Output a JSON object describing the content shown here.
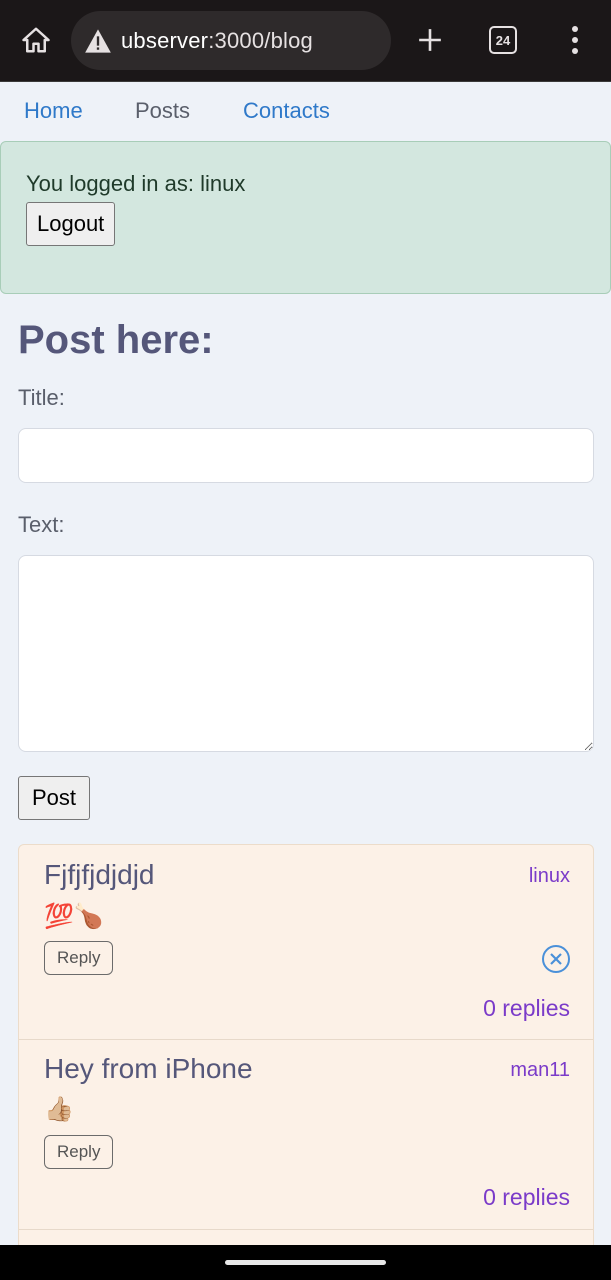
{
  "browser": {
    "url_host": "ubserver",
    "url_path": ":3000/blog",
    "tab_count": "24",
    "icons": {
      "home": "home-icon",
      "warning": "warning-icon",
      "new_tab": "plus-icon",
      "tabs": "tab-switcher-icon",
      "menu": "more-vert-icon"
    }
  },
  "nav": {
    "home": "Home",
    "posts": "Posts",
    "contacts": "Contacts",
    "link_color": "#2f79c9",
    "active_color": "#5a5f6b"
  },
  "login": {
    "text": "You logged in as: linux",
    "logout_label": "Logout"
  },
  "form": {
    "heading": "Post here:",
    "title_label": "Title:",
    "title_value": "",
    "text_label": "Text:",
    "text_value": "",
    "submit_label": "Post"
  },
  "posts": [
    {
      "title": "Fjfjfjdjdjd",
      "author": "linux",
      "body": "💯🍗",
      "reply_label": "Reply",
      "replies": "0 replies",
      "deletable": true
    },
    {
      "title": "Hey from iPhone",
      "author": "man11",
      "body": "👍🏼",
      "reply_label": "Reply",
      "replies": "0 replies",
      "deletable": false
    }
  ],
  "colors": {
    "login_bg": "#d3e7df",
    "post_bg": "#fcf1e7",
    "author": "#7b3bc9",
    "heading": "#55577a"
  }
}
